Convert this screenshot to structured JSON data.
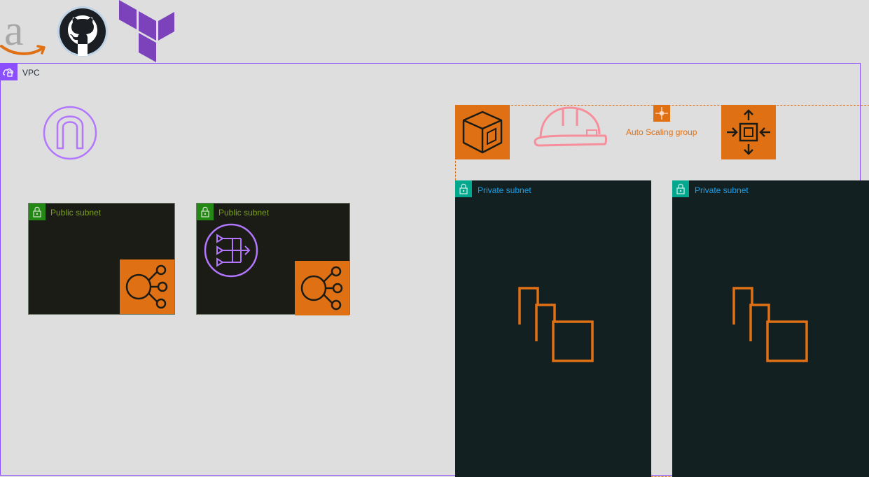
{
  "vpc": {
    "label": "VPC"
  },
  "public_subnets": [
    {
      "label": "Public subnet"
    },
    {
      "label": "Public subnet"
    }
  ],
  "private_subnets": [
    {
      "label": "Private subnet"
    },
    {
      "label": "Private subnet"
    }
  ],
  "auto_scaling": {
    "label": "Auto Scaling group"
  },
  "colors": {
    "vpc": "#8c4fff",
    "aws_orange": "#e07014",
    "public_subnet": "#248814",
    "private_subnet": "#01a88d",
    "private_text": "#1b9ee6",
    "public_text": "#7aa116",
    "helmet": "#f78e9c"
  },
  "icons": [
    "amazon-logo-icon",
    "github-logo-icon",
    "terraform-logo-icon",
    "vpc-cloud-icon",
    "internet-gateway-icon",
    "lock-icon",
    "elastic-load-balancer-icon",
    "nat-gateway-icon",
    "ec2-auto-scaling-icon",
    "hard-hat-icon",
    "auto-scaling-arrows-icon",
    "elastic-ip-icon",
    "ec2-instances-icon"
  ]
}
